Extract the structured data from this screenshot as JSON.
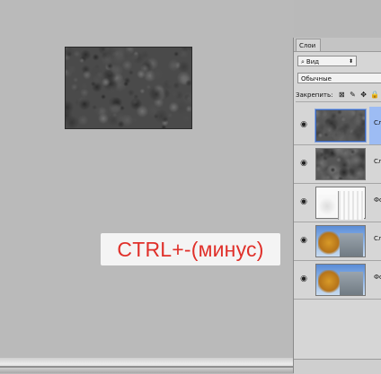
{
  "tooltip": {
    "text": "CTRL+-(минус)"
  },
  "panel": {
    "tab_label": "Слои",
    "kind_filter": {
      "icon": "search-icon",
      "value": "Вид"
    },
    "blend_mode": "Обычные",
    "lock_label": "Закрепить:",
    "layers": [
      {
        "name": "Сл",
        "thumbnail": "noise",
        "visible": true,
        "selected": true
      },
      {
        "name": "Сл",
        "thumbnail": "noise",
        "visible": true,
        "selected": false
      },
      {
        "name": "Фо",
        "thumbnail": "sketch",
        "visible": true,
        "selected": false
      },
      {
        "name": "Сл",
        "thumbnail": "photo",
        "visible": true,
        "selected": false
      },
      {
        "name": "Фо",
        "thumbnail": "photo",
        "visible": true,
        "selected": false
      }
    ]
  },
  "colors": {
    "tooltip_text": "#e0302a",
    "selected_layer": "#9dbcf4",
    "workspace": "#bababa"
  }
}
